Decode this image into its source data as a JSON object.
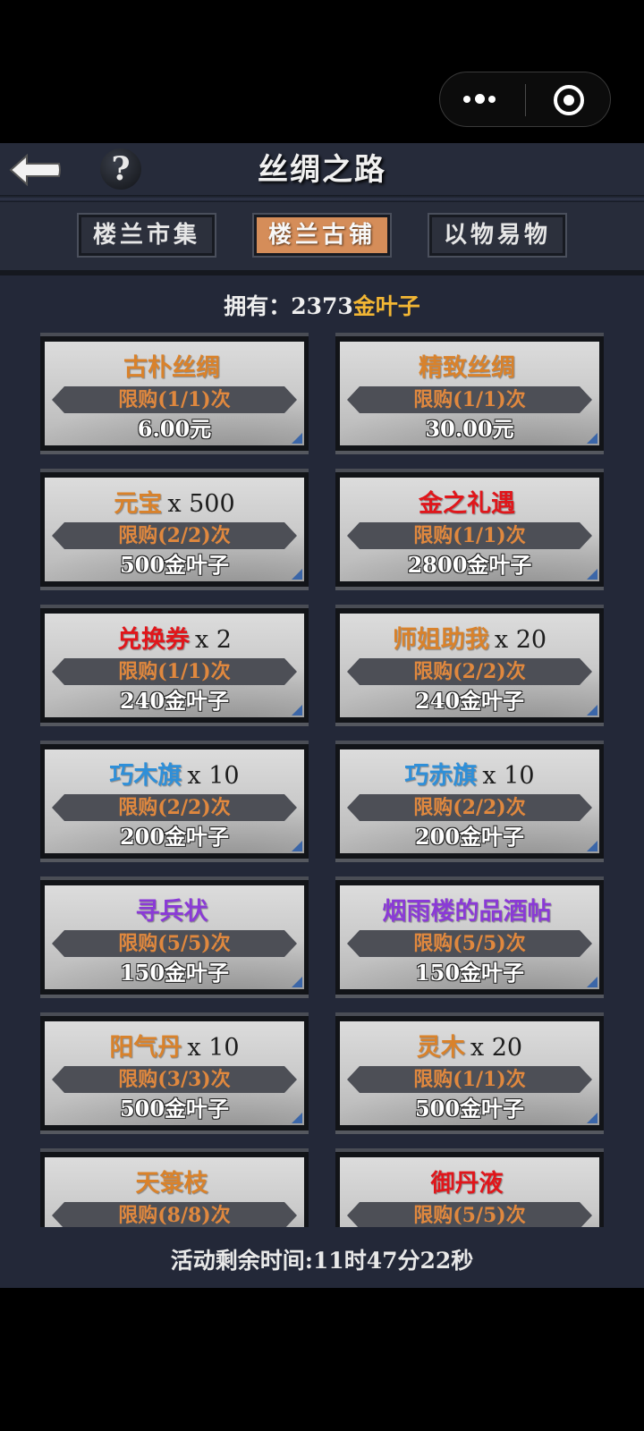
{
  "colors": {
    "orange": "#d9822b",
    "red": "#e0161b",
    "blue": "#2f8fd8",
    "purple": "#8a3ad6",
    "gold": "#f2b634",
    "tab_active": "#d58d59"
  },
  "header": {
    "title": "丝绸之路",
    "help_icon": "?"
  },
  "tabs": [
    {
      "label": "楼兰市集",
      "active": false
    },
    {
      "label": "楼兰古铺",
      "active": true
    },
    {
      "label": "以物易物",
      "active": false
    }
  ],
  "owned": {
    "label": "拥有：",
    "amount": "2373",
    "currency": "金叶子"
  },
  "items": [
    {
      "name": "古朴丝绸",
      "qty": "",
      "color": "#d9822b",
      "limit": "限购(1/1)次",
      "price": "6.00元"
    },
    {
      "name": "精致丝绸",
      "qty": "",
      "color": "#d9822b",
      "limit": "限购(1/1)次",
      "price": "30.00元"
    },
    {
      "name": "元宝",
      "qty": "x 500",
      "color": "#d9822b",
      "limit": "限购(2/2)次",
      "price": "500金叶子"
    },
    {
      "name": "金之礼遇",
      "qty": "",
      "color": "#e0161b",
      "limit": "限购(1/1)次",
      "price": "2800金叶子"
    },
    {
      "name": "兑换券",
      "qty": "x 2",
      "color": "#e0161b",
      "limit": "限购(1/1)次",
      "price": "240金叶子"
    },
    {
      "name": "师姐助我",
      "qty": "x 20",
      "color": "#d9822b",
      "limit": "限购(2/2)次",
      "price": "240金叶子"
    },
    {
      "name": "巧木旗",
      "qty": "x 10",
      "color": "#2f8fd8",
      "limit": "限购(2/2)次",
      "price": "200金叶子"
    },
    {
      "name": "巧赤旗",
      "qty": "x 10",
      "color": "#2f8fd8",
      "limit": "限购(2/2)次",
      "price": "200金叶子"
    },
    {
      "name": "寻兵状",
      "qty": "",
      "color": "#8a3ad6",
      "limit": "限购(5/5)次",
      "price": "150金叶子"
    },
    {
      "name": "烟雨楼的品酒帖",
      "qty": "",
      "color": "#8a3ad6",
      "limit": "限购(5/5)次",
      "price": "150金叶子"
    },
    {
      "name": "阳气丹",
      "qty": "x 10",
      "color": "#d9822b",
      "limit": "限购(3/3)次",
      "price": "500金叶子"
    },
    {
      "name": "灵木",
      "qty": "x 20",
      "color": "#d9822b",
      "limit": "限购(1/1)次",
      "price": "500金叶子"
    },
    {
      "name": "天箓枝",
      "qty": "",
      "color": "#d9822b",
      "limit": "限购(8/8)次",
      "price": ""
    },
    {
      "name": "御丹液",
      "qty": "",
      "color": "#e0161b",
      "limit": "限购(5/5)次",
      "price": ""
    }
  ],
  "footer": {
    "countdown": "活动剩余时间:11时47分22秒"
  }
}
